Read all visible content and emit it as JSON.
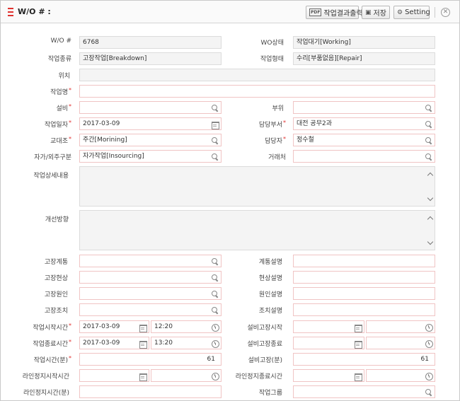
{
  "header": {
    "title": "W/O # :",
    "buttons": {
      "report": "작업결과출력",
      "save": "저장",
      "setting": "Setting"
    },
    "pdf_icon_text": "PDF"
  },
  "form": {
    "wo_no": {
      "label": "W/O #",
      "value": "6768"
    },
    "wo_status": {
      "label": "WO상태",
      "value": "작업대기[Working]"
    },
    "work_type": {
      "label": "작업종류",
      "value": "고장작업[Breakdown]"
    },
    "work_form": {
      "label": "작업형태",
      "value": "수리[부품없음][Repair]"
    },
    "location": {
      "label": "위치",
      "value": ""
    },
    "work_name": {
      "label": "작업명",
      "value": ""
    },
    "equipment": {
      "label": "설비",
      "value": ""
    },
    "part": {
      "label": "부위",
      "value": ""
    },
    "work_date": {
      "label": "작업일자",
      "value": "2017-03-09"
    },
    "dept": {
      "label": "담당부서",
      "value": "대전 공무2과"
    },
    "shift": {
      "label": "교대조",
      "value": "주간[Morining]"
    },
    "person": {
      "label": "담당자",
      "value": "정수철"
    },
    "inout": {
      "label": "자가/외주구분",
      "value": "자가작업[Insourcing]"
    },
    "vendor": {
      "label": "거래처",
      "value": ""
    },
    "detail": {
      "label": "작업상세내용",
      "value": ""
    },
    "improve": {
      "label": "개선방향",
      "value": ""
    },
    "fault_system": {
      "label": "고장계통",
      "value": ""
    },
    "system_desc": {
      "label": "계통설명",
      "value": ""
    },
    "fault_symptom": {
      "label": "고장현상",
      "value": ""
    },
    "symptom_desc": {
      "label": "현상설명",
      "value": ""
    },
    "fault_cause": {
      "label": "고장원인",
      "value": ""
    },
    "cause_desc": {
      "label": "원인설명",
      "value": ""
    },
    "fault_action": {
      "label": "고장조치",
      "value": ""
    },
    "action_desc": {
      "label": "조치설명",
      "value": ""
    },
    "start_time": {
      "label": "작업시작시간",
      "date": "2017-03-09",
      "time": "12:20"
    },
    "eq_fault_start": {
      "label": "설비고장시작",
      "date": "",
      "time": ""
    },
    "end_time": {
      "label": "작업종료시간",
      "date": "2017-03-09",
      "time": "13:20"
    },
    "eq_fault_end": {
      "label": "설비고장종료",
      "date": "",
      "time": ""
    },
    "work_minutes": {
      "label": "작업시간(분)",
      "value": "61"
    },
    "eq_fault_minutes": {
      "label": "설비고장(분)",
      "value": "61"
    },
    "line_stop_start": {
      "label": "라인정지시작시간",
      "date": "",
      "time": ""
    },
    "line_stop_end": {
      "label": "라인정지종료시간",
      "date": "",
      "time": ""
    },
    "line_stop_minutes": {
      "label": "라인정지시간(분)",
      "value": ""
    },
    "work_group": {
      "label": "작업그룹",
      "value": ""
    }
  }
}
